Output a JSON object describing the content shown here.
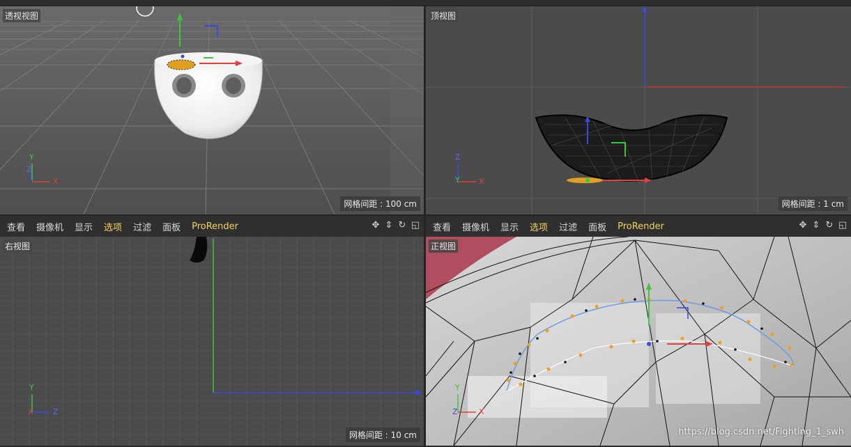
{
  "menu": {
    "items": [
      "查看",
      "摄像机",
      "显示",
      "选项",
      "过滤",
      "面板",
      "ProRender"
    ],
    "selected_item": "选项"
  },
  "nav_icons": [
    "move-view-icon",
    "zoom-view-icon",
    "rotate-view-icon",
    "maximize-view-icon"
  ],
  "viewports": {
    "perspective": {
      "label": "透视视图",
      "grid": "网格间距 : 100 cm"
    },
    "top": {
      "label": "顶视图",
      "grid": "网格间距 : 1 cm"
    },
    "right": {
      "label": "右视图",
      "grid": "网格间距 : 10 cm"
    },
    "front": {
      "label": "正视图"
    }
  },
  "axes": {
    "x": "X",
    "y": "Y",
    "z": "Z"
  },
  "watermark": "https://blog.csdn.net/Fighting_1_swh",
  "colors": {
    "accent": "#f3d35f",
    "x_axis": "#e04040",
    "y_axis": "#3fc63f",
    "z_axis": "#3a49e0"
  }
}
